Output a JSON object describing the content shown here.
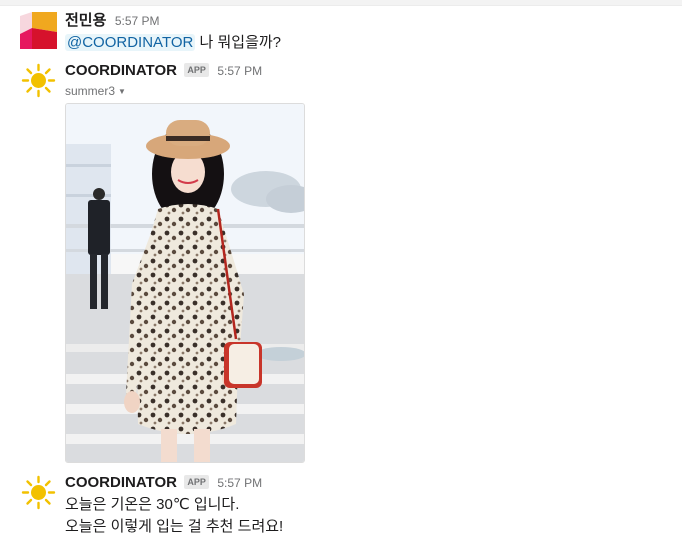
{
  "colors": {
    "accent_mention": "#1264a3",
    "sun": "#f2c100"
  },
  "messages": [
    {
      "sender": "전민용",
      "time": "5:57 PM",
      "mention": "@COORDINATOR",
      "text": " 나 뭐입을까?",
      "avatar_icon": "slack-user-avatar"
    },
    {
      "sender": "COORDINATOR",
      "badge": "APP",
      "time": "5:57 PM",
      "attachment_title": "summer3",
      "attachment_icon": "caret-down-icon",
      "image_alt": "photo of a woman in floral dress and straw hat",
      "avatar_icon": "sun-icon"
    },
    {
      "sender": "COORDINATOR",
      "badge": "APP",
      "time": "5:57 PM",
      "lines": [
        "오늘은 기온은 30℃ 입니다.",
        "오늘은 이렇게 입는 걸 추천 드려요!"
      ],
      "avatar_icon": "sun-icon"
    }
  ]
}
